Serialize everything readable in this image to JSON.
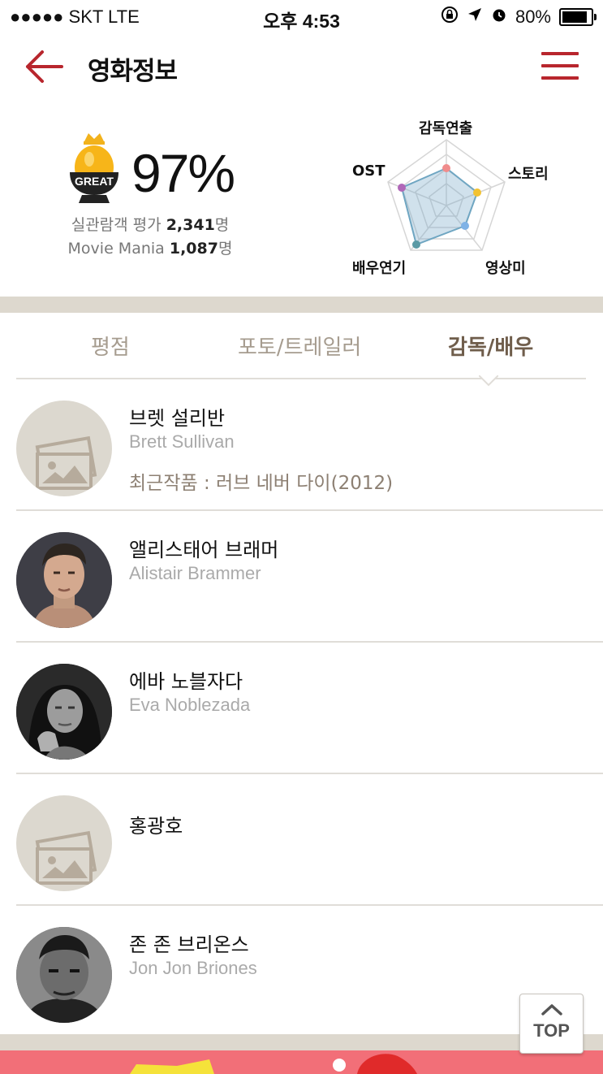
{
  "status": {
    "carrier": "●●●●● SKT  LTE",
    "time": "오후 4:53",
    "battery": "80%"
  },
  "header": {
    "title": "영화정보"
  },
  "summary": {
    "badge": "GREAT",
    "percent": "97%",
    "audience_label": "실관람객 평가",
    "audience_count": "2,341",
    "audience_unit": "명",
    "mania_label": "Movie Mania",
    "mania_count": "1,087",
    "mania_unit": "명",
    "radar": {
      "labels": [
        "감독연출",
        "스토리",
        "영상미",
        "배우연기",
        "OST"
      ],
      "point_colors": [
        "#f08c8c",
        "#f2c232",
        "#7fb2e6",
        "#5a9aa5",
        "#b067b8"
      ]
    }
  },
  "tabs": [
    {
      "label": "평점",
      "active": false
    },
    {
      "label": "포토/트레일러",
      "active": false
    },
    {
      "label": "감독/배우",
      "active": true
    }
  ],
  "people": [
    {
      "name_ko": "브렛 설리반",
      "name_en": "Brett Sullivan",
      "recent": "최근작품 : 러브 네버 다이(2012)",
      "photo": "placeholder"
    },
    {
      "name_ko": "앨리스태어 브래머",
      "name_en": "Alistair Brammer",
      "recent": "",
      "photo": "portrait"
    },
    {
      "name_ko": "에바 노블자다",
      "name_en": "Eva Noblezada",
      "recent": "",
      "photo": "portrait"
    },
    {
      "name_ko": "홍광호",
      "name_en": "",
      "recent": "",
      "photo": "placeholder"
    },
    {
      "name_ko": "존 존 브리온스",
      "name_en": "Jon Jon Briones",
      "recent": "",
      "photo": "portrait"
    }
  ],
  "top_button": {
    "label": "TOP"
  }
}
